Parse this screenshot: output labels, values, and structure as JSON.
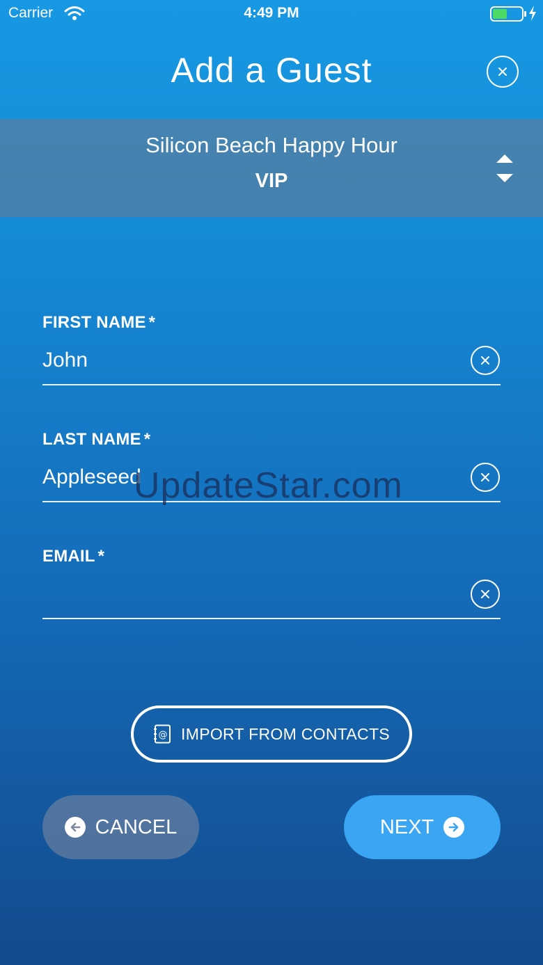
{
  "status_bar": {
    "carrier": "Carrier",
    "time": "4:49 PM",
    "battery_color": "#4cd964"
  },
  "header": {
    "title": "Add a Guest"
  },
  "event": {
    "name": "Silicon Beach Happy Hour",
    "ticket_type": "VIP"
  },
  "form": {
    "first_name": {
      "label": "FIRST NAME",
      "required_mark": "*",
      "value": "John"
    },
    "last_name": {
      "label": "LAST NAME",
      "required_mark": "*",
      "value": "Appleseed"
    },
    "email": {
      "label": "EMAIL",
      "required_mark": "*",
      "value": ""
    }
  },
  "watermark": "UpdateStar.com",
  "buttons": {
    "import_label": "IMPORT FROM CONTACTS",
    "cancel_label": "CANCEL",
    "next_label": "NEXT"
  },
  "colors": {
    "next_button": "#3aa6f3",
    "background_top": "#1798e3",
    "background_bottom": "#134b8c"
  },
  "icons": [
    "wifi-icon",
    "battery-icon",
    "bolt-icon",
    "close-icon",
    "sort-icon",
    "clear-icon",
    "contacts-icon",
    "arrow-left-icon",
    "arrow-right-icon"
  ]
}
